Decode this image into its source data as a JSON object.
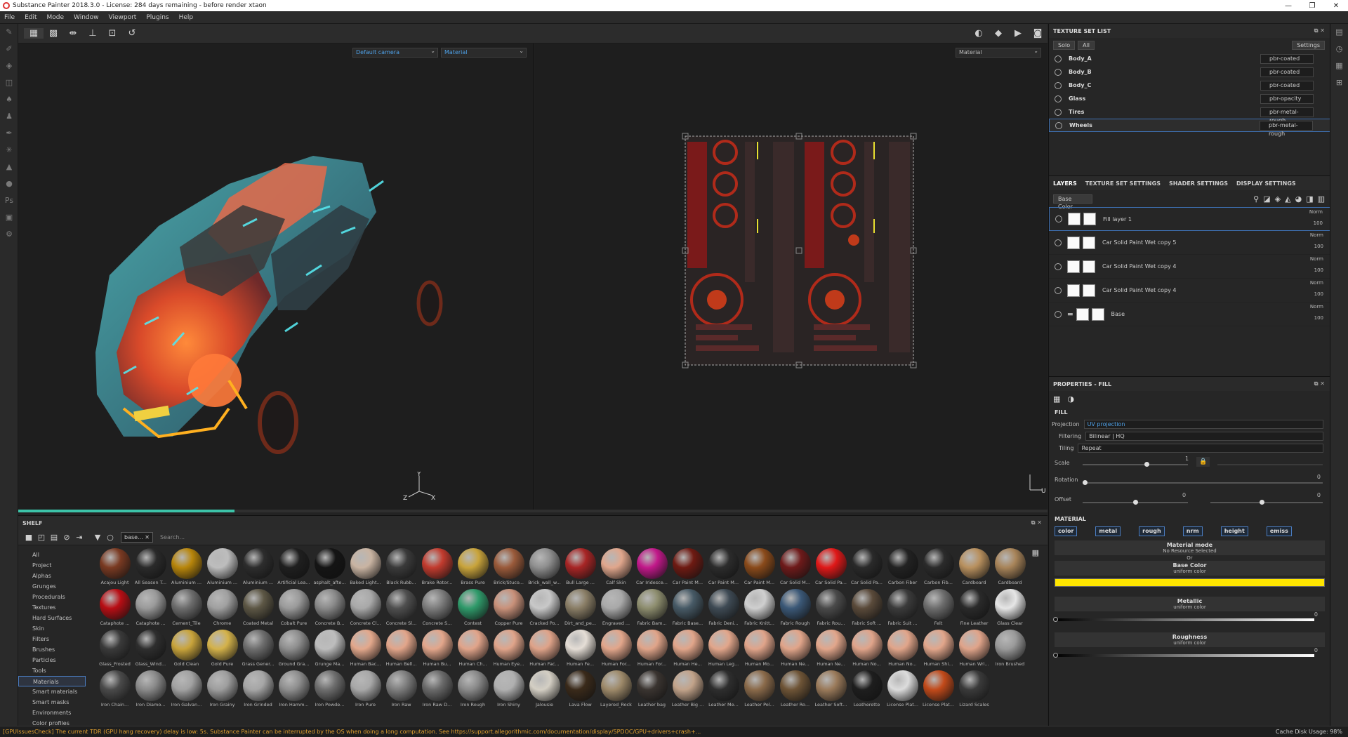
{
  "app": {
    "title": "Substance Painter 2018.3.0 - License: 284 days remaining - before render xtaon"
  },
  "menu": [
    "File",
    "Edit",
    "Mode",
    "Window",
    "Viewport",
    "Plugins",
    "Help"
  ],
  "viewport": {
    "camera": "Default camera",
    "mode3d": "Material",
    "mode2d": "Material"
  },
  "shelf": {
    "title": "SHELF",
    "filter_tag": "base...",
    "search_placeholder": "Search...",
    "categories": [
      "All",
      "Project",
      "Alphas",
      "Grunges",
      "Procedurals",
      "Textures",
      "Hard Surfaces",
      "Skin",
      "Filters",
      "Brushes",
      "Particles",
      "Tools",
      "Materials",
      "Smart materials",
      "Smart masks",
      "Environments",
      "Color profiles"
    ],
    "selected_category": "Materials",
    "materials": [
      [
        "Acajou Light",
        "#7a3a22"
      ],
      [
        "All Season T...",
        "#2a2a2a"
      ],
      [
        "Aluminium ...",
        "#b8860b"
      ],
      [
        "Aluminium ...",
        "#bdbdbd"
      ],
      [
        "Aluminium ...",
        "#2d2d2d"
      ],
      [
        "Artificial Lea...",
        "#1f1f1f"
      ],
      [
        "asphalt_afte...",
        "#141414"
      ],
      [
        "Baked Light...",
        "#c9b4a2"
      ],
      [
        "Black Rubb...",
        "#3a3a3a"
      ],
      [
        "Brake Rotor...",
        "#c23b2e"
      ],
      [
        "Brass Pure",
        "#c9a43b"
      ],
      [
        "Brick/Stuco...",
        "#9a5a3a"
      ],
      [
        "Brick_wall_w...",
        "#8f8f8f"
      ],
      [
        "Bull Large ...",
        "#a82525"
      ],
      [
        "Calf Skin",
        "#e0a68c"
      ],
      [
        "Car Iridesce...",
        "#c2188a"
      ],
      [
        "Car Paint M...",
        "#6e1a12"
      ],
      [
        "Car Paint M...",
        "#2c2c2c"
      ],
      [
        "Car Paint M...",
        "#8a4a1a"
      ],
      [
        "Car Solid M...",
        "#6e1a1a"
      ],
      [
        "Car Solid Pa...",
        "#e01818"
      ],
      [
        "Car Solid Pa...",
        "#2a2a2a"
      ],
      [
        "Carbon Fiber",
        "#222222"
      ],
      [
        "Carbon Fib...",
        "#2b2b2b"
      ],
      [
        "Cardboard",
        "#b8905e"
      ],
      [
        "Cardboard",
        "#a88459"
      ],
      [
        "Cataphote ...",
        "#b80e14"
      ],
      [
        "Cataphote ...",
        "#9a9a9a"
      ],
      [
        "Cement_Tile",
        "#6d6d6d"
      ],
      [
        "Chrome",
        "#a0a0a0"
      ],
      [
        "Coated Metal",
        "#5d5745"
      ],
      [
        "Cobalt Pure",
        "#9a9a9a"
      ],
      [
        "Concrete B...",
        "#8a8a8a"
      ],
      [
        "Concrete Cl...",
        "#a9a9a9"
      ],
      [
        "Concrete Sl...",
        "#4f4f4f"
      ],
      [
        "Concrete S...",
        "#7d7d7d"
      ],
      [
        "Contest",
        "#2f9a6a"
      ],
      [
        "Copper Pure",
        "#c9917a"
      ],
      [
        "Cracked Po...",
        "#c8c8c8"
      ],
      [
        "Dirt_and_pe...",
        "#8a7e66"
      ],
      [
        "Engraved ...",
        "#a9a9a9"
      ],
      [
        "Fabric Bam...",
        "#8d8d6e"
      ],
      [
        "Fabric Base...",
        "#475a66"
      ],
      [
        "Fabric Deni...",
        "#3e4a54"
      ],
      [
        "Fabric Knitt...",
        "#cfcfcf"
      ],
      [
        "Fabric Rough",
        "#3b5877"
      ],
      [
        "Fabric Rou...",
        "#4a4a4a"
      ],
      [
        "Fabric Soft ...",
        "#5a4a3a"
      ],
      [
        "Fabric Suit ...",
        "#3b3b3b"
      ],
      [
        "Felt",
        "#6d6d6d"
      ],
      [
        "Fine Leather",
        "#2a2a2a"
      ],
      [
        "Glass Clear",
        "#e6e6e6"
      ],
      [
        "Glass_Frosted",
        "#3a3a3a"
      ],
      [
        "Glass_Wind...",
        "#2e2e2e"
      ],
      [
        "Gold Clean",
        "#c9a43b"
      ],
      [
        "Gold Pure",
        "#d4b24a"
      ],
      [
        "Grass Gener...",
        "#6e6e6e"
      ],
      [
        "Ground Gra...",
        "#8e8e8e"
      ],
      [
        "Grunge Ma...",
        "#bdbdbd"
      ],
      [
        "Human Bac...",
        "#e3a88c"
      ],
      [
        "Human Bell...",
        "#e2a58a"
      ],
      [
        "Human Bu...",
        "#e3a68b"
      ],
      [
        "Human Ch...",
        "#e1a48a"
      ],
      [
        "Human Eye...",
        "#e0a48a"
      ],
      [
        "Human Fac...",
        "#dfa389"
      ],
      [
        "Human Fe...",
        "#e5ded6"
      ],
      [
        "Human For...",
        "#e2a68b"
      ],
      [
        "Human For...",
        "#e0a489"
      ],
      [
        "Human He...",
        "#e1a58a"
      ],
      [
        "Human Leg...",
        "#e2a68b"
      ],
      [
        "Human Mo...",
        "#e0a48a"
      ],
      [
        "Human Ne...",
        "#e1a58a"
      ],
      [
        "Human Ne...",
        "#e2a68b"
      ],
      [
        "Human No...",
        "#e0a48a"
      ],
      [
        "Human No...",
        "#e1a58a"
      ],
      [
        "Human Shi...",
        "#e2a68b"
      ],
      [
        "Human Wri...",
        "#e0a48a"
      ],
      [
        "Iron Brushed",
        "#9a9a9a"
      ],
      [
        "Iron Chain...",
        "#4a4a4a"
      ],
      [
        "Iron Diamo...",
        "#8a8a8a"
      ],
      [
        "Iron Galvan...",
        "#a2a2a2"
      ],
      [
        "Iron Grainy",
        "#9e9e9e"
      ],
      [
        "Iron Grinded",
        "#a6a6a6"
      ],
      [
        "Iron Hamm...",
        "#8e8e8e"
      ],
      [
        "Iron Powde...",
        "#6e6e6e"
      ],
      [
        "Iron Pure",
        "#a8a8a8"
      ],
      [
        "Iron Raw",
        "#7e7e7e"
      ],
      [
        "Iron Raw D...",
        "#6a6a6a"
      ],
      [
        "Iron Rough",
        "#8a8a8a"
      ],
      [
        "Iron Shiny",
        "#b0b0b0"
      ],
      [
        "Jalousie",
        "#d4cfc4"
      ],
      [
        "Lava Flow",
        "#3a2a1a"
      ],
      [
        "Layered_Rock",
        "#9e8a6a"
      ],
      [
        "Leather bag",
        "#3a3430"
      ],
      [
        "Leather Big ...",
        "#c2a38a"
      ],
      [
        "Leather Me...",
        "#2e2e2e"
      ],
      [
        "Leather Pol...",
        "#8a6a4a"
      ],
      [
        "Leather Ro...",
        "#6e5436"
      ],
      [
        "Leather Soft...",
        "#9a7a5a"
      ],
      [
        "Leatherette",
        "#1e1e1e"
      ],
      [
        "License Plat...",
        "#dcdcdc"
      ],
      [
        "License Plat...",
        "#c24a1a"
      ],
      [
        "Lizard Scales",
        "#3a3a3a"
      ]
    ]
  },
  "texture_set_list": {
    "title": "TEXTURE SET LIST",
    "solo": "Solo",
    "all": "All",
    "settings": "Settings",
    "sets": [
      {
        "name": "Body_A",
        "shader": "pbr-coated"
      },
      {
        "name": "Body_B",
        "shader": "pbr-coated"
      },
      {
        "name": "Body_C",
        "shader": "pbr-coated"
      },
      {
        "name": "Glass",
        "shader": "pbr-opacity"
      },
      {
        "name": "Tires",
        "shader": "pbr-metal-rough"
      },
      {
        "name": "Wheels",
        "shader": "pbr-metal-rough"
      }
    ]
  },
  "layers": {
    "tabs": [
      "LAYERS",
      "TEXTURE SET SETTINGS",
      "SHADER SETTINGS",
      "DISPLAY SETTINGS"
    ],
    "channel": "Base Color",
    "items": [
      {
        "name": "Fill layer 1",
        "blend": "Norm",
        "opacity": "100"
      },
      {
        "name": "Car Solid Paint Wet copy 5",
        "blend": "Norm",
        "opacity": "100"
      },
      {
        "name": "Car Solid Paint Wet copy 4",
        "blend": "Norm",
        "opacity": "100"
      },
      {
        "name": "Car Solid Paint Wet copy 4",
        "blend": "Norm",
        "opacity": "100"
      },
      {
        "name": "Base",
        "blend": "Norm",
        "opacity": "100"
      }
    ]
  },
  "properties": {
    "title": "PROPERTIES - FILL",
    "fill": "FILL",
    "projection_label": "Projection",
    "projection": "UV projection",
    "filtering_label": "Filtering",
    "filtering": "Bilinear | HQ",
    "tiling_label": "Tiling",
    "tiling": "Repeat",
    "scale_label": "Scale",
    "scale_value": "1",
    "rotation_label": "Rotation",
    "rotation_value": "0",
    "offset_label": "Offset",
    "offset_x": "0",
    "offset_y": "0",
    "material": "MATERIAL",
    "channels": [
      "color",
      "metal",
      "rough",
      "nrm",
      "height",
      "emiss"
    ],
    "material_mode": "Material mode",
    "no_resource": "No Resource Selected",
    "or": "Or",
    "base_color": "Base Color",
    "uniform": "uniform color",
    "metallic": "Metallic",
    "metallic_value": "0",
    "roughness": "Roughness",
    "roughness_value": "0",
    "base_color_hex": "#ffe600"
  },
  "status": {
    "message": "[GPUIssuesCheck] The current TDR (GPU hang recovery) delay is low: 5s. Substance Painter can be interrupted by the OS when doing a long computation. See https://support.allegorithmic.com/documentation/display/SPDOC/GPU+drivers+crash+...",
    "cache": "Cache Disk Usage:   98%"
  },
  "progress": 0.21
}
